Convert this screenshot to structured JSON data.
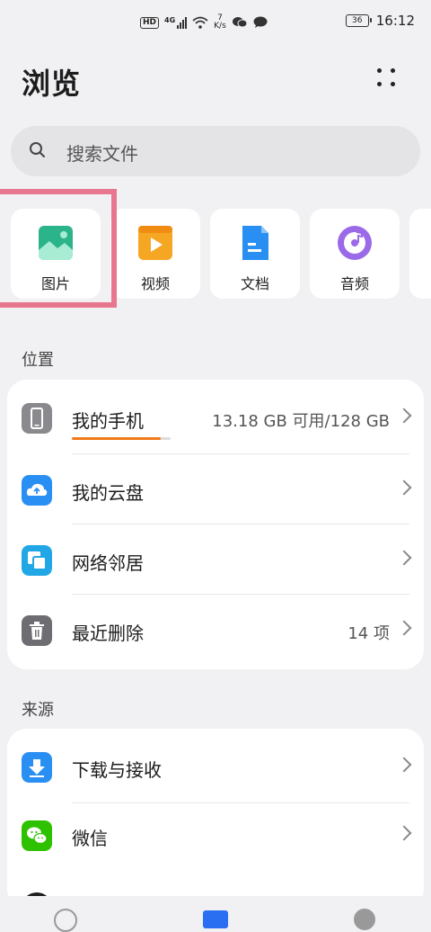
{
  "status_bar": {
    "hd": "HD",
    "network": "4G",
    "speed_value": "7",
    "speed_unit": "K/s",
    "battery": "36",
    "time": "16:12"
  },
  "header": {
    "title": "浏览"
  },
  "search": {
    "placeholder": "搜索文件"
  },
  "categories": [
    {
      "label": "图片",
      "icon": "image-icon",
      "color": "#2bb38a"
    },
    {
      "label": "视频",
      "icon": "video-icon",
      "color": "#f5a623"
    },
    {
      "label": "文档",
      "icon": "document-icon",
      "color": "#2a8ff2"
    },
    {
      "label": "音频",
      "icon": "audio-icon",
      "color": "#9b6ae8"
    }
  ],
  "locations": {
    "section_title": "位置",
    "items": [
      {
        "label": "我的手机",
        "value": "13.18 GB 可用/128 GB",
        "icon": "phone-icon",
        "color": "#8a8a8e",
        "used_fraction": 0.9
      },
      {
        "label": "我的云盘",
        "value": "",
        "icon": "cloud-icon",
        "color": "#2a8ff2"
      },
      {
        "label": "网络邻居",
        "value": "",
        "icon": "network-icon",
        "color": "#22a7e6"
      },
      {
        "label": "最近删除",
        "value": "14 项",
        "icon": "trash-icon",
        "color": "#6e6e72"
      }
    ]
  },
  "sources": {
    "section_title": "来源",
    "items": [
      {
        "label": "下载与接收",
        "icon": "download-icon",
        "color": "#2a8ff2"
      },
      {
        "label": "微信",
        "icon": "wechat-icon",
        "color": "#2dc100"
      }
    ]
  }
}
